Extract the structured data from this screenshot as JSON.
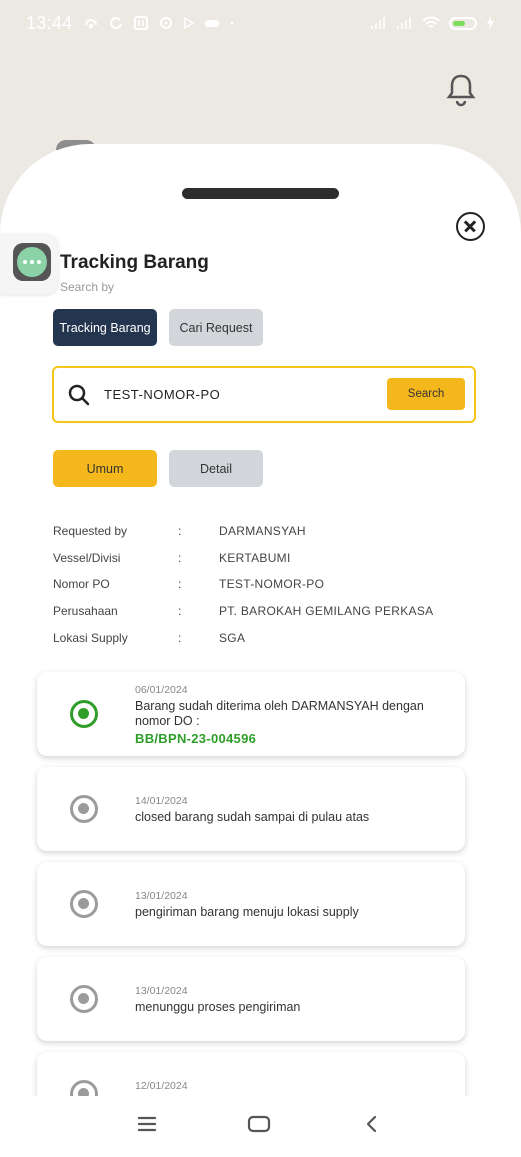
{
  "status_bar": {
    "time": "13:44"
  },
  "sheet": {
    "title": "Tracking Barang",
    "subtitle": "Search by",
    "tabs": [
      {
        "label": "Tracking Barang",
        "active": true
      },
      {
        "label": "Cari Request",
        "active": false
      }
    ],
    "search": {
      "value": "TEST-NOMOR-PO",
      "button_label": "Search"
    },
    "segments": [
      {
        "label": "Umum",
        "active": true
      },
      {
        "label": "Detail",
        "active": false
      }
    ],
    "info_rows": [
      {
        "key": "Requested by",
        "sep": ":",
        "value": "DARMANSYAH"
      },
      {
        "key": "Vessel/Divisi",
        "sep": ":",
        "value": "KERTABUMI"
      },
      {
        "key": "Nomor PO",
        "sep": ":",
        "value": "TEST-NOMOR-PO"
      },
      {
        "key": "Perusahaan",
        "sep": ":",
        "value": "PT. BAROKAH GEMILANG PERKASA"
      },
      {
        "key": "Lokasi Supply",
        "sep": ":",
        "value": "SGA"
      }
    ],
    "timeline": [
      {
        "date": "06/01/2024",
        "text": "Barang sudah diterima oleh DARMANSYAH dengan nomor DO :",
        "code": "BB/BPN-23-004596",
        "active": true
      },
      {
        "date": "14/01/2024",
        "text": "closed barang sudah sampai di pulau atas",
        "active": false
      },
      {
        "date": "13/01/2024",
        "text": "pengiriman barang menuju lokasi supply",
        "active": false
      },
      {
        "date": "13/01/2024",
        "text": "menunggu proses pengiriman",
        "active": false
      },
      {
        "date": "12/01/2024",
        "text": "",
        "active": false
      }
    ]
  },
  "colors": {
    "accent_yellow": "#f5b81c",
    "navy": "#24364f",
    "success_green": "#2e9e28",
    "inactive_gray": "#d2d5da"
  },
  "icons": {
    "notification": "bell-icon",
    "close": "close-circle-icon",
    "search": "search-icon",
    "floating": "chat-bubble-icon",
    "nav": [
      "menu-icon",
      "home-icon",
      "back-icon"
    ]
  }
}
